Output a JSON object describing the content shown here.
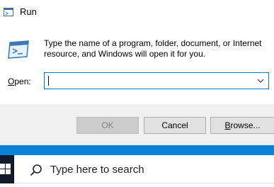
{
  "window": {
    "title": "Run",
    "description": "Type the name of a program, folder, document, or Internet resource, and Windows will open it for you."
  },
  "open_field": {
    "label_prefix": "",
    "label_accel": "O",
    "label_suffix": "pen:",
    "value": ""
  },
  "buttons": {
    "ok": "OK",
    "cancel": "Cancel",
    "browse_accel": "B",
    "browse_suffix": "rowse..."
  },
  "taskbar": {
    "search_placeholder": "Type here to search"
  },
  "colors": {
    "accent": "#0078d7",
    "taskbar_accent": "#0a82d8"
  }
}
